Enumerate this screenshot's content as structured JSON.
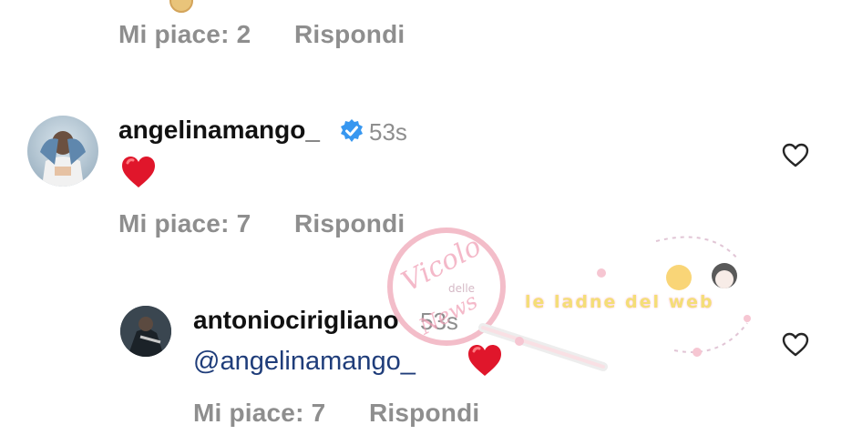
{
  "top_comment": {
    "likes_label": "Mi piace: 2",
    "reply_label": "Rispondi"
  },
  "comment1": {
    "username": "angelinamango_",
    "verified": true,
    "time": "53s",
    "content_emoji": "red-heart",
    "likes_label": "Mi piace: 7",
    "reply_label": "Rispondi"
  },
  "reply1": {
    "username": "antoniocirigliano",
    "time": "53s",
    "mention": "@angelinamango_",
    "content_emoji": "red-heart",
    "likes_label": "Mi piace: 7",
    "reply_label": "Rispondi"
  },
  "colors": {
    "meta_gray": "#8e8e8e",
    "mention_blue": "#1f3d7a",
    "verified_blue": "#3797f0",
    "heart_red": "#e0162b"
  },
  "watermark": {
    "magnifier_text_1": "Vicolo",
    "magnifier_text_2": "delle",
    "magnifier_text_3": "News",
    "banner_text": "le ladne del web"
  }
}
